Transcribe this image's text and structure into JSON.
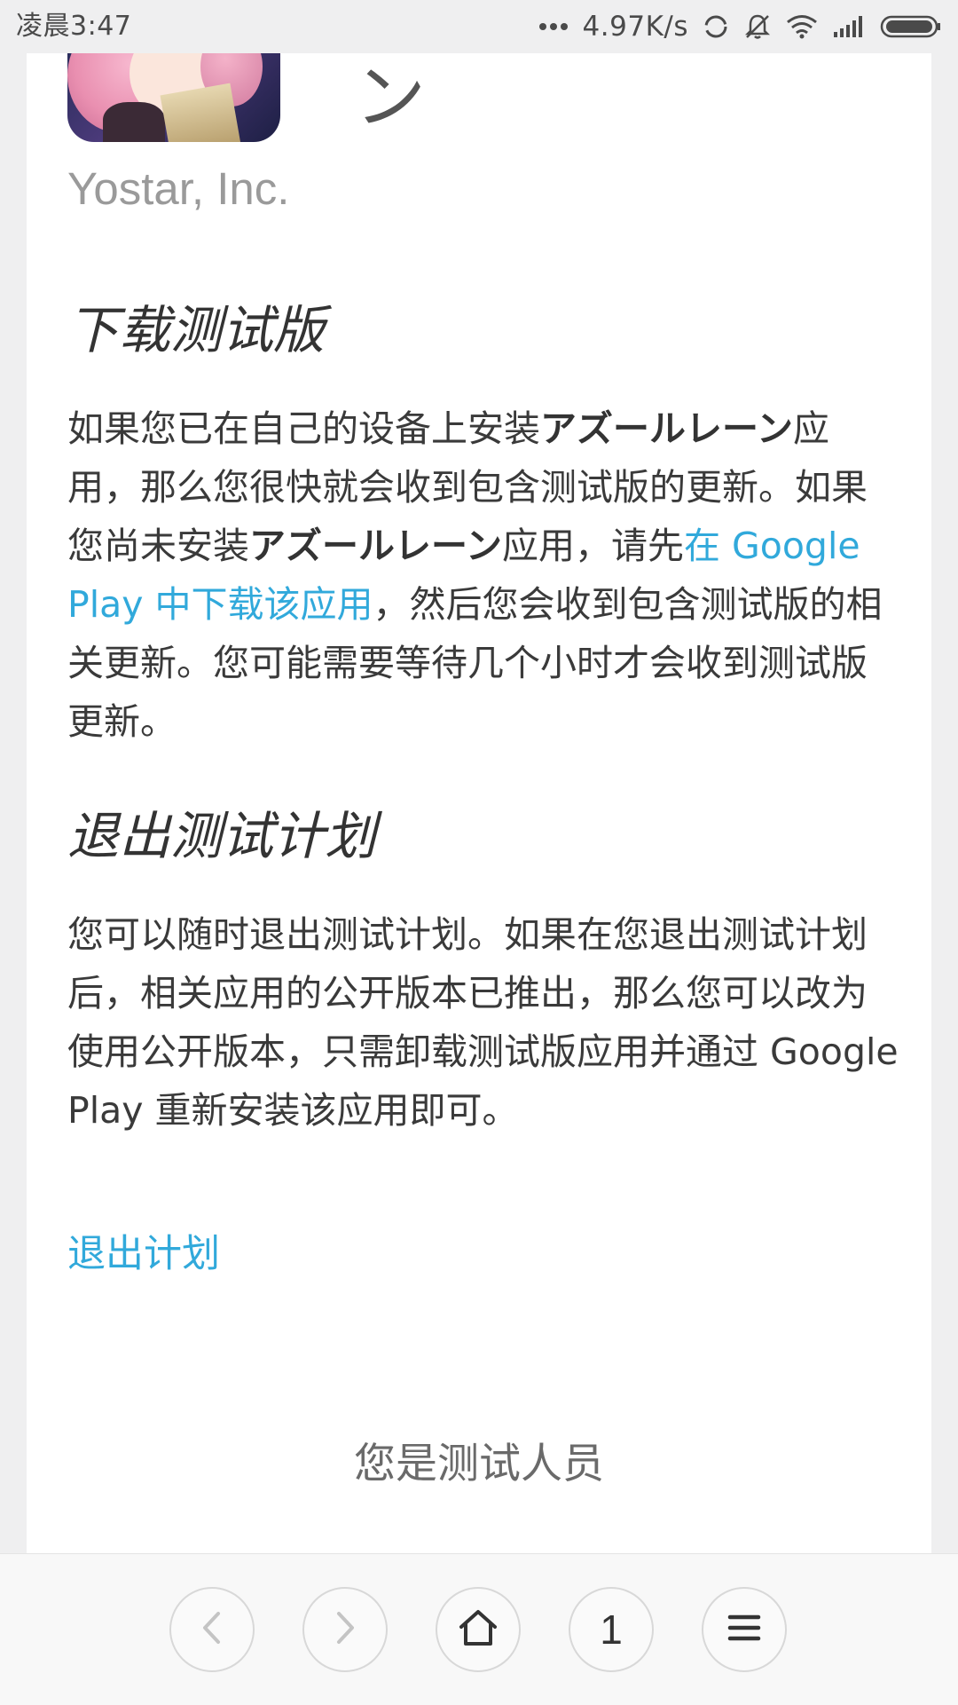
{
  "status_bar": {
    "time": "凌晨3:47",
    "network_speed": "4.97K/s",
    "icons": [
      "more-dots-icon",
      "sync-icon",
      "bell-off-icon",
      "wifi-icon",
      "signal-icon",
      "battery-icon"
    ]
  },
  "app": {
    "title_tail": "ン",
    "developer": "Yostar, Inc."
  },
  "download_section": {
    "title": "下载测试版",
    "text_1": "如果您已在自己的设备上安装",
    "app_name_1": "アズールレーン",
    "text_2": "应用，那么您很快就会收到包含测试版的更新。如果您尚未安装",
    "app_name_2": "アズールレーン",
    "text_3": "应用，请先",
    "link": "在 Google Play 中下载该应用",
    "text_4": "，然后您会收到包含测试版的相关更新。您可能需要等待几个小时才会收到测试版更新。"
  },
  "exit_section": {
    "title": "退出测试计划",
    "text": "您可以随时退出测试计划。如果在您退出测试计划后，相关应用的公开版本已推出，那么您可以改为使用公开版本，只需卸载测试版应用并通过 Google Play 重新安装该应用即可。",
    "link": "退出计划"
  },
  "footer": {
    "tester_label": "您是测试人员"
  },
  "bottom_nav": {
    "tab_count": "1",
    "icons": [
      "back-icon",
      "forward-icon",
      "home-icon",
      "tabs-icon",
      "menu-icon"
    ]
  }
}
